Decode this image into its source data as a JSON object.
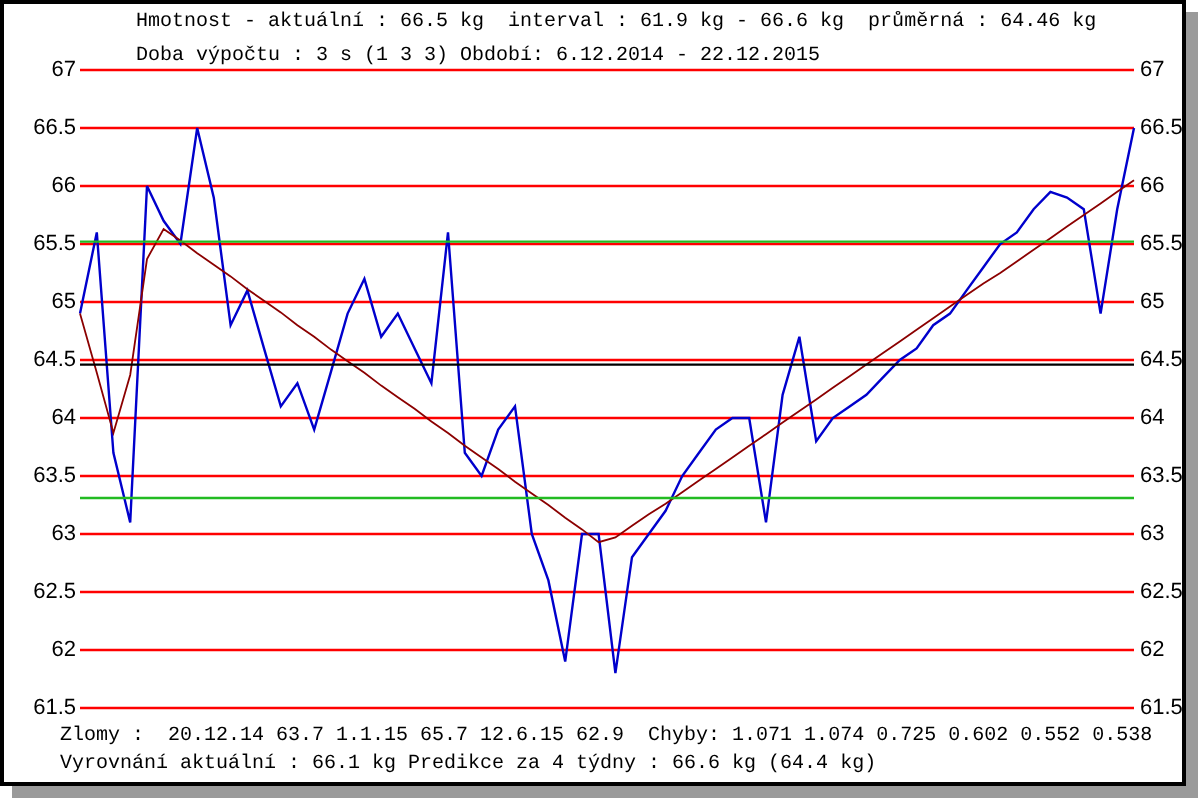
{
  "header": {
    "line_1": "Hmotnost - aktuální : 66.5 kg  interval : 61.9 kg - 66.6 kg  průměrná : 64.46 kg",
    "line_2": "Doba výpočtu : 3 s (1 3 3) Období: 6.12.2014 - 22.12.2015"
  },
  "chart_data": {
    "type": "line",
    "ylim": [
      61.5,
      67
    ],
    "yticks": [
      61.5,
      62,
      62.5,
      63,
      63.5,
      64,
      64.5,
      65,
      65.5,
      66,
      66.5,
      67
    ],
    "categories": [
      null,
      null,
      null,
      null,
      null,
      null,
      null,
      null,
      null,
      null,
      null,
      null,
      null,
      null,
      null,
      null,
      null,
      null,
      null,
      null,
      null,
      null,
      null,
      null,
      null,
      null,
      null,
      null,
      null,
      null,
      null,
      null,
      null,
      null,
      null,
      null,
      null,
      null,
      null,
      null,
      null,
      null,
      null,
      null,
      null,
      null,
      null,
      null,
      null,
      null,
      null,
      null,
      null,
      null,
      null,
      null,
      null,
      null,
      null,
      null,
      null,
      null,
      null,
      null
    ],
    "series": [
      {
        "color": "#0000cc",
        "values": [
          64.9,
          65.6,
          63.7,
          63.1,
          66.0,
          65.7,
          65.5,
          66.5,
          65.9,
          64.8,
          65.1,
          64.6,
          64.1,
          64.3,
          63.9,
          64.4,
          64.9,
          65.2,
          64.7,
          64.9,
          64.6,
          64.3,
          65.6,
          63.7,
          63.5,
          63.9,
          64.1,
          63.0,
          62.6,
          61.9,
          63.0,
          63.0,
          61.8,
          62.8,
          63.0,
          63.2,
          63.5,
          63.7,
          63.9,
          64.0,
          64.0,
          63.1,
          64.2,
          64.7,
          63.8,
          64.0,
          64.1,
          64.2,
          64.35,
          64.5,
          64.6,
          64.8,
          64.9,
          65.1,
          65.3,
          65.5,
          65.6,
          65.8,
          65.95,
          65.9,
          65.8,
          64.9,
          65.8,
          66.5
        ]
      },
      {
        "color": "#8b0000",
        "values": [
          64.9,
          64.39,
          63.87,
          64.37,
          65.37,
          65.63,
          65.53,
          65.42,
          65.32,
          65.22,
          65.11,
          65.01,
          64.91,
          64.8,
          64.7,
          64.59,
          64.49,
          64.39,
          64.28,
          64.18,
          64.08,
          63.97,
          63.87,
          63.76,
          63.66,
          63.56,
          63.45,
          63.35,
          63.25,
          63.14,
          63.04,
          62.93,
          62.97,
          63.07,
          63.17,
          63.26,
          63.36,
          63.46,
          63.56,
          63.66,
          63.76,
          63.86,
          63.96,
          64.06,
          64.16,
          64.26,
          64.36,
          64.46,
          64.56,
          64.66,
          64.76,
          64.86,
          64.96,
          65.06,
          65.16,
          65.25,
          65.35,
          65.45,
          65.55,
          65.65,
          65.75,
          65.85,
          65.95,
          66.05
        ]
      },
      {
        "color": "#000000",
        "values": [
          64.46,
          64.46,
          64.46,
          64.46,
          64.46,
          64.46,
          64.46,
          64.46,
          64.46,
          64.46,
          64.46,
          64.46,
          64.46,
          64.46,
          64.46,
          64.46,
          64.46,
          64.46,
          64.46,
          64.46,
          64.46,
          64.46,
          64.46,
          64.46,
          64.46,
          64.46,
          64.46,
          64.46,
          64.46,
          64.46,
          64.46,
          64.46,
          64.46,
          64.46,
          64.46,
          64.46,
          64.46,
          64.46,
          64.46,
          64.46,
          64.46,
          64.46,
          64.46,
          64.46,
          64.46,
          64.46,
          64.46,
          64.46,
          64.46,
          64.46,
          64.46,
          64.46,
          64.46,
          64.46,
          64.46,
          64.46,
          64.46,
          64.46,
          64.46,
          64.46,
          64.46,
          64.46,
          64.46,
          64.46
        ]
      },
      {
        "color": "#22bb22",
        "values": [
          65.52,
          65.52,
          65.52,
          65.52,
          65.52,
          65.52,
          65.52,
          65.52,
          65.52,
          65.52,
          65.52,
          65.52,
          65.52,
          65.52,
          65.52,
          65.52,
          65.52,
          65.52,
          65.52,
          65.52,
          65.52,
          65.52,
          65.52,
          65.52,
          65.52,
          65.52,
          65.52,
          65.52,
          65.52,
          65.52,
          65.52,
          65.52,
          65.52,
          65.52,
          65.52,
          65.52,
          65.52,
          65.52,
          65.52,
          65.52,
          65.52,
          65.52,
          65.52,
          65.52,
          65.52,
          65.52,
          65.52,
          65.52,
          65.52,
          65.52,
          65.52,
          65.52,
          65.52,
          65.52,
          65.52,
          65.52,
          65.52,
          65.52,
          65.52,
          65.52,
          65.52,
          65.52,
          65.52,
          65.52
        ]
      },
      {
        "color": "#22bb22",
        "values": [
          63.31,
          63.31,
          63.31,
          63.31,
          63.31,
          63.31,
          63.31,
          63.31,
          63.31,
          63.31,
          63.31,
          63.31,
          63.31,
          63.31,
          63.31,
          63.31,
          63.31,
          63.31,
          63.31,
          63.31,
          63.31,
          63.31,
          63.31,
          63.31,
          63.31,
          63.31,
          63.31,
          63.31,
          63.31,
          63.31,
          63.31,
          63.31,
          63.31,
          63.31,
          63.31,
          63.31,
          63.31,
          63.31,
          63.31,
          63.31,
          63.31,
          63.31,
          63.31,
          63.31,
          63.31,
          63.31,
          63.31,
          63.31,
          63.31,
          63.31,
          63.31,
          63.31,
          63.31,
          63.31,
          63.31,
          63.31,
          63.31,
          63.31,
          63.31,
          63.31,
          63.31,
          63.31,
          63.31,
          63.31
        ]
      }
    ],
    "grid": true
  },
  "right_axis": {
    "labels": [
      "67",
      "66.5",
      "66",
      "65.5",
      "65",
      "64.5",
      "64",
      "63.5",
      "63",
      "62.5",
      "62",
      "61.5"
    ]
  },
  "footer": {
    "line_1": "Zlomy :  20.12.14 63.7 1.1.15 65.7 12.6.15 62.9  Chyby: 1.071 1.074 0.725 0.602 0.552 0.538",
    "line_2": "Vyrovnání aktuální : 66.1 kg Predikce za 4 týdny : 66.6 kg (64.4 kg)"
  }
}
